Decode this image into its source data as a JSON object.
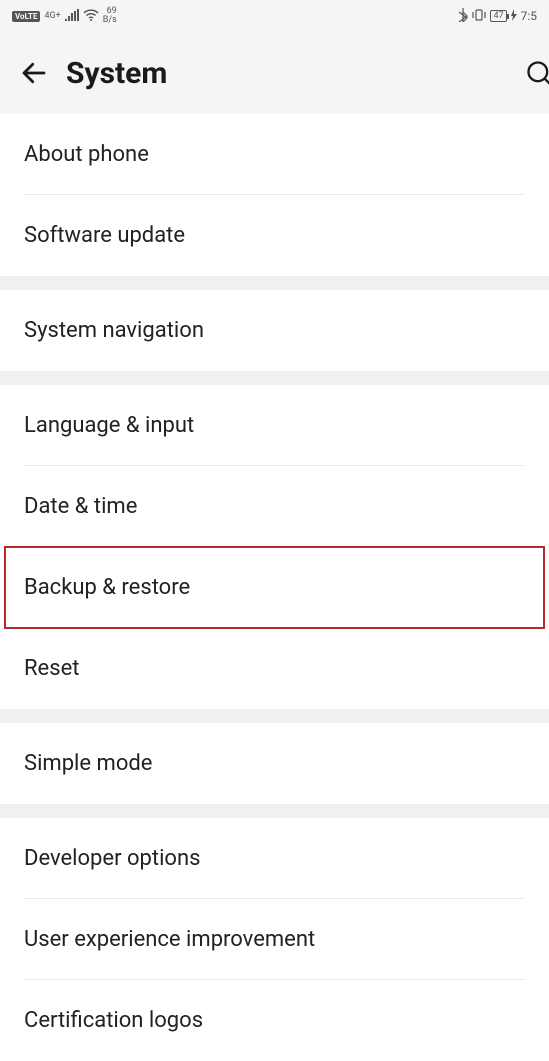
{
  "status": {
    "volte": "VoLTE",
    "net": "4G+",
    "speed_top": "69",
    "speed_bottom": "B/s",
    "battery": "47",
    "time": "7:5"
  },
  "header": {
    "title": "System"
  },
  "groups": [
    {
      "items": [
        {
          "label": "About phone",
          "name": "item-about-phone"
        },
        {
          "label": "Software update",
          "name": "item-software-update"
        }
      ]
    },
    {
      "items": [
        {
          "label": "System navigation",
          "name": "item-system-navigation"
        }
      ]
    },
    {
      "items": [
        {
          "label": "Language & input",
          "name": "item-language-input"
        },
        {
          "label": "Date & time",
          "name": "item-date-time"
        },
        {
          "label": "Backup & restore",
          "name": "item-backup-restore",
          "highlight": true
        },
        {
          "label": "Reset",
          "name": "item-reset"
        }
      ]
    },
    {
      "items": [
        {
          "label": "Simple mode",
          "name": "item-simple-mode"
        }
      ]
    },
    {
      "items": [
        {
          "label": "Developer options",
          "name": "item-developer-options"
        },
        {
          "label": "User experience improvement",
          "name": "item-user-experience"
        },
        {
          "label": "Certification logos",
          "name": "item-certification-logos"
        }
      ]
    }
  ]
}
